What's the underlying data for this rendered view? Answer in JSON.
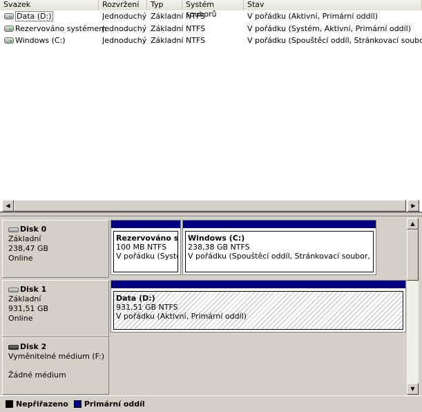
{
  "volume_list": {
    "columns": [
      "Svazek",
      "Rozvržení",
      "Typ",
      "Systém souborů",
      "Stav"
    ],
    "rows": [
      {
        "name": "Data (D:)",
        "layout": "Jednoduchý",
        "type": "Základní",
        "fs": "NTFS",
        "status": "V pořádku (Aktivní, Primární oddíl)"
      },
      {
        "name": "Rezervováno systémem",
        "layout": "Jednoduchý",
        "type": "Základní",
        "fs": "NTFS",
        "status": "V pořádku (Systém, Aktivní, Primární oddíl)"
      },
      {
        "name": "Windows (C:)",
        "layout": "Jednoduchý",
        "type": "Základní",
        "fs": "NTFS",
        "status": "V pořádku (Spouštěcí oddíl, Stránkovací soubor, Sta"
      }
    ]
  },
  "disks": [
    {
      "name": "Disk 0",
      "kind": "Základní",
      "size": "238,47 GB",
      "state": "Online",
      "partitions": [
        {
          "name": "Rezervováno sy",
          "size": "100 MB NTFS",
          "status": "V pořádku (Systém"
        },
        {
          "name": "Windows  (C:)",
          "size": "238,38 GB NTFS",
          "status": "V pořádku (Spouštěcí oddíl, Stránkovací soubor, Stav sy"
        }
      ]
    },
    {
      "name": "Disk 1",
      "kind": "Základní",
      "size": "931,51 GB",
      "state": "Online",
      "partitions": [
        {
          "name": "Data  (D:)",
          "size": "931,51 GB NTFS",
          "status": "V pořádku (Aktivní, Primární oddíl)"
        }
      ]
    },
    {
      "name": "Disk 2",
      "kind": "Vyměnitelné médium (F:)",
      "size": "",
      "state": "Žádné médium",
      "partitions": []
    }
  ],
  "legend": {
    "unallocated": "Nepřiřazeno",
    "primary": "Primární oddíl",
    "unallocated_color": "#000000",
    "primary_color": "#000080"
  },
  "icons": {
    "scroll_left": "◀",
    "scroll_right": "▶",
    "scroll_up": "▲",
    "scroll_down": "▼"
  }
}
